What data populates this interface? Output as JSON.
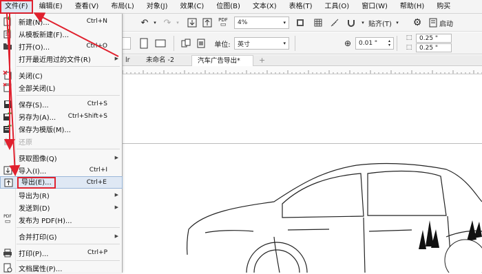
{
  "menubar": {
    "items": [
      "文件(F)",
      "编辑(E)",
      "查看(V)",
      "布局(L)",
      "对象(J)",
      "效果(C)",
      "位图(B)",
      "文本(X)",
      "表格(T)",
      "工具(O)",
      "窗口(W)",
      "帮助(H)",
      "购买"
    ]
  },
  "file_menu": {
    "items": [
      {
        "label": "新建(N)...",
        "shortcut": "Ctrl+N",
        "icon": "new-doc-icon"
      },
      {
        "label": "从模板新建(F)...",
        "shortcut": "",
        "icon": "template-icon"
      },
      {
        "label": "打开(O)...",
        "shortcut": "Ctrl+O",
        "icon": "folder-icon"
      },
      {
        "label": "打开最近用过的文件(R)",
        "shortcut": "",
        "icon": "",
        "submenu": true
      },
      {
        "label": "关闭(C)",
        "shortcut": "",
        "icon": "close-doc-icon"
      },
      {
        "label": "全部关闭(L)",
        "shortcut": "",
        "icon": "close-all-icon"
      },
      {
        "label": "保存(S)...",
        "shortcut": "Ctrl+S",
        "icon": "save-icon"
      },
      {
        "label": "另存为(A)...",
        "shortcut": "Ctrl+Shift+S",
        "icon": "save-as-icon"
      },
      {
        "label": "保存为模版(M)...",
        "shortcut": "",
        "icon": "save-template-icon"
      },
      {
        "label": "还原",
        "shortcut": "",
        "icon": "revert-icon",
        "disabled": true
      },
      {
        "label": "获取图像(Q)",
        "shortcut": "",
        "icon": "",
        "submenu": true
      },
      {
        "label": "导入(I)...",
        "shortcut": "Ctrl+I",
        "icon": "import-icon"
      },
      {
        "label": "导出(E)...",
        "shortcut": "Ctrl+E",
        "icon": "export-icon"
      },
      {
        "label": "导出为(R)",
        "shortcut": "",
        "icon": "",
        "submenu": true
      },
      {
        "label": "发送到(D)",
        "shortcut": "",
        "icon": "",
        "submenu": true
      },
      {
        "label": "发布为 PDF(H)...",
        "shortcut": "",
        "icon": "pdf-icon"
      },
      {
        "label": "合并打印(G)",
        "shortcut": "",
        "icon": "",
        "submenu": true
      },
      {
        "label": "打印(P)...",
        "shortcut": "Ctrl+P",
        "icon": "print-icon"
      },
      {
        "label": "文档属性(P)...",
        "shortcut": "",
        "icon": "doc-props-icon"
      }
    ]
  },
  "toolbar1": {
    "zoom": "4%",
    "snap_label": "贴齐(T)",
    "launch_label": "启动"
  },
  "toolbar2": {
    "unit_label": "单位:",
    "unit_value": "英寸",
    "nudge": "0.01 \"",
    "dup_x": "0.25 \"",
    "dup_y": "0.25 \""
  },
  "tabs": {
    "partial": "lr",
    "items": [
      "未命名 -2",
      "汽车广告导出*"
    ],
    "add": "+"
  },
  "colors": {
    "accent_red": "#e0212e",
    "highlight": "#dfe8f4"
  }
}
